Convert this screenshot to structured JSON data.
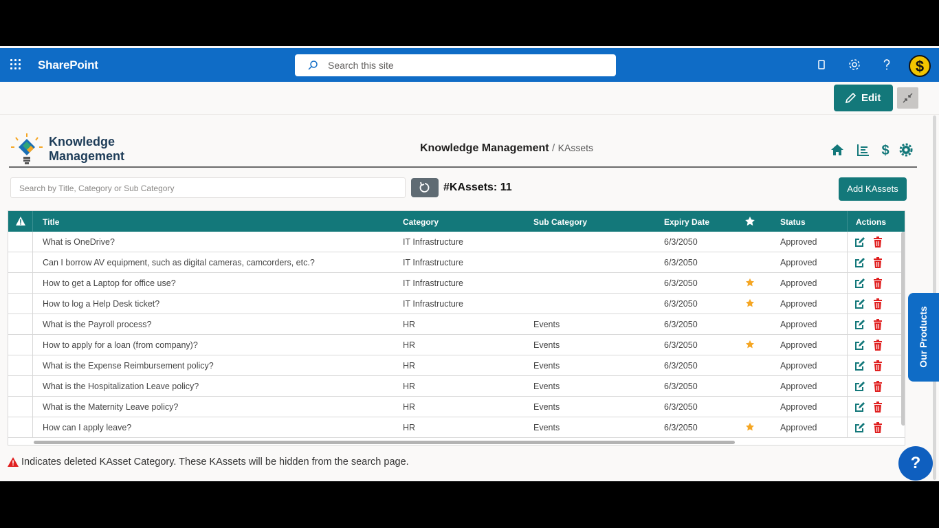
{
  "suite": {
    "brand": "SharePoint",
    "search_placeholder": "Search this site"
  },
  "command": {
    "edit_label": "Edit"
  },
  "header": {
    "logo_line1": "Knowledge",
    "logo_line2": "Management",
    "breadcrumb_root": "Knowledge Management",
    "breadcrumb_sep": "/",
    "breadcrumb_current": "KAssets"
  },
  "toolbar": {
    "search_placeholder": "Search by Title, Category or Sub Category",
    "count_label": "#KAssets: 11",
    "add_label": "Add KAssets"
  },
  "table": {
    "columns": {
      "title": "Title",
      "category": "Category",
      "subcategory": "Sub Category",
      "expiry": "Expiry Date",
      "status": "Status",
      "actions": "Actions"
    },
    "rows": [
      {
        "title": "What is OneDrive?",
        "category": "IT Infrastructure",
        "subcategory": "",
        "expiry": "6/3/2050",
        "featured": false,
        "status": "Approved"
      },
      {
        "title": "Can I borrow AV equipment, such as digital cameras, camcorders, etc.?",
        "category": "IT Infrastructure",
        "subcategory": "",
        "expiry": "6/3/2050",
        "featured": false,
        "status": "Approved"
      },
      {
        "title": "How to get a Laptop for office use?",
        "category": "IT Infrastructure",
        "subcategory": "",
        "expiry": "6/3/2050",
        "featured": true,
        "status": "Approved"
      },
      {
        "title": "How to log a Help Desk ticket?",
        "category": "IT Infrastructure",
        "subcategory": "",
        "expiry": "6/3/2050",
        "featured": true,
        "status": "Approved"
      },
      {
        "title": "What is the Payroll process?",
        "category": "HR",
        "subcategory": "Events",
        "expiry": "6/3/2050",
        "featured": false,
        "status": "Approved"
      },
      {
        "title": "How to apply for a loan (from company)?",
        "category": "HR",
        "subcategory": "Events",
        "expiry": "6/3/2050",
        "featured": true,
        "status": "Approved"
      },
      {
        "title": "What is the Expense Reimbursement policy?",
        "category": "HR",
        "subcategory": "Events",
        "expiry": "6/3/2050",
        "featured": false,
        "status": "Approved"
      },
      {
        "title": "What is the Hospitalization Leave policy?",
        "category": "HR",
        "subcategory": "Events",
        "expiry": "6/3/2050",
        "featured": false,
        "status": "Approved"
      },
      {
        "title": "What is the Maternity Leave policy?",
        "category": "HR",
        "subcategory": "Events",
        "expiry": "6/3/2050",
        "featured": false,
        "status": "Approved"
      },
      {
        "title": "How can I apply leave?",
        "category": "HR",
        "subcategory": "Events",
        "expiry": "6/3/2050",
        "featured": true,
        "status": "Approved"
      }
    ]
  },
  "footnote": "Indicates deleted KAsset Category. These KAssets will be hidden from the search page.",
  "side_tab": "Our Products",
  "help_fab": "?",
  "colors": {
    "suite_blue": "#0f6cc6",
    "teal": "#13787a",
    "star": "#f5a623",
    "delete_red": "#e02020",
    "warning_red": "#e02020"
  },
  "icons": [
    "waffle-icon",
    "search-icon",
    "mobile-icon",
    "gear-icon",
    "help-icon",
    "pencil-icon",
    "collapse-icon",
    "home-icon",
    "chart-icon",
    "dollar-icon",
    "settings-icon",
    "reset-icon",
    "warning-icon",
    "star-icon",
    "edit-icon",
    "delete-icon"
  ]
}
